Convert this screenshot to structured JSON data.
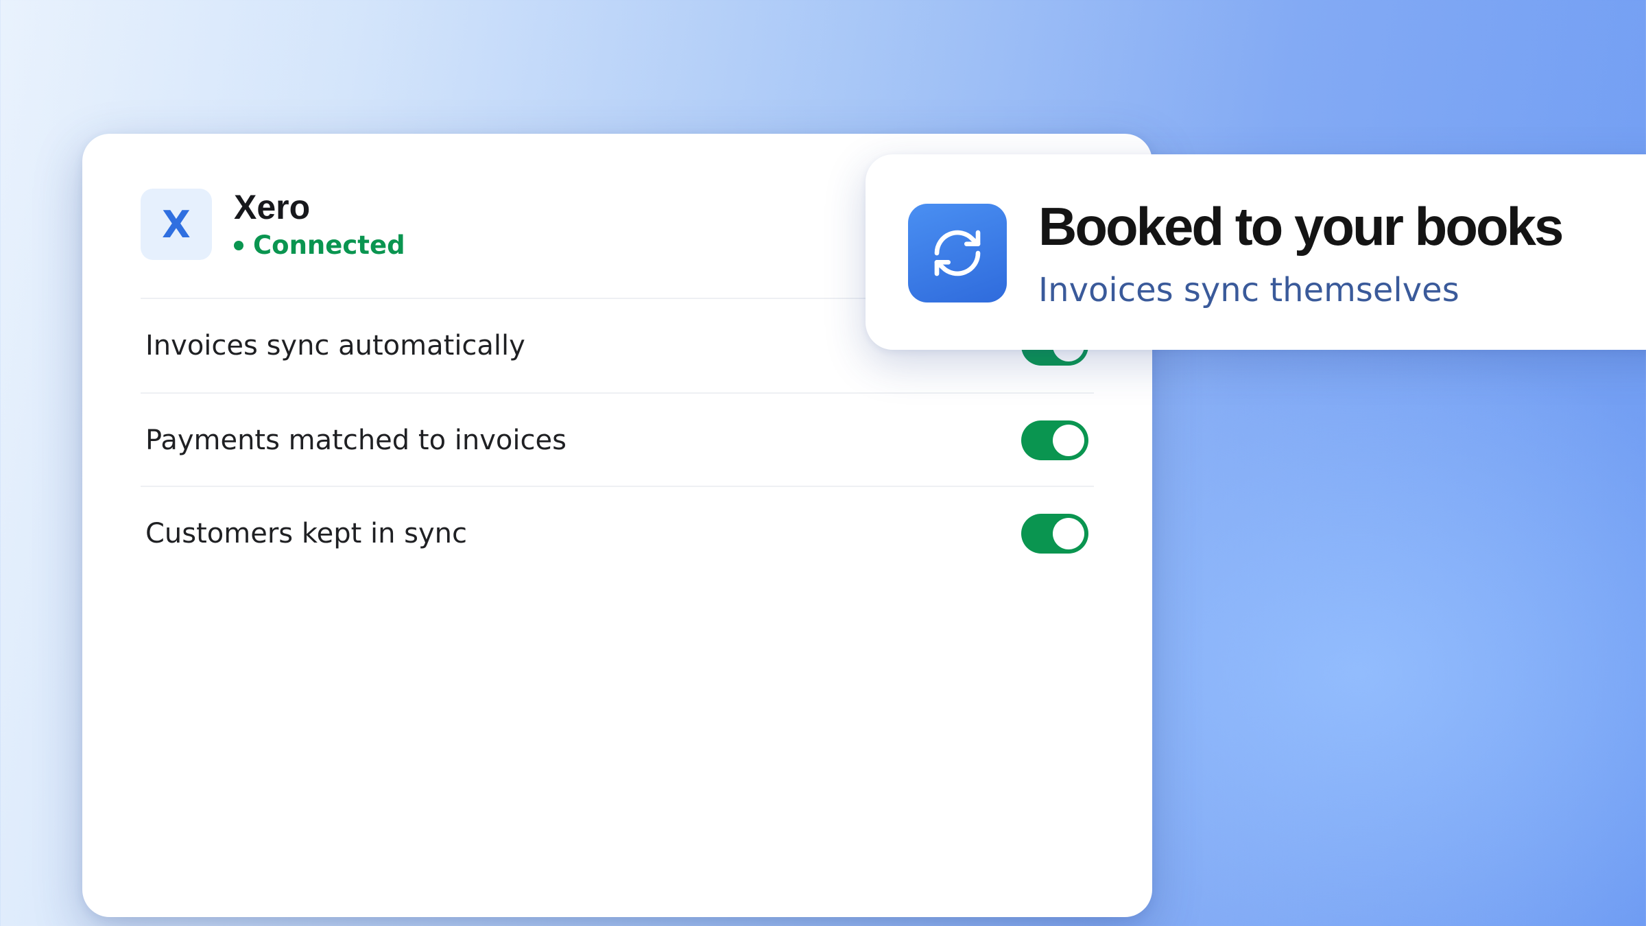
{
  "integration": {
    "logo_letter": "X",
    "name": "Xero",
    "status": "Connected",
    "logo_icon": "xero-logo-icon",
    "status_color": "#0a9550"
  },
  "settings": [
    {
      "label": "Invoices sync automatically",
      "enabled": true
    },
    {
      "label": "Payments matched to invoices",
      "enabled": true
    },
    {
      "label": "Customers kept in sync",
      "enabled": true
    }
  ],
  "callout": {
    "title": "Booked to your books",
    "subtitle": "Invoices sync themselves",
    "icon": "sync-icon",
    "accent_color": "#3a7be8"
  }
}
